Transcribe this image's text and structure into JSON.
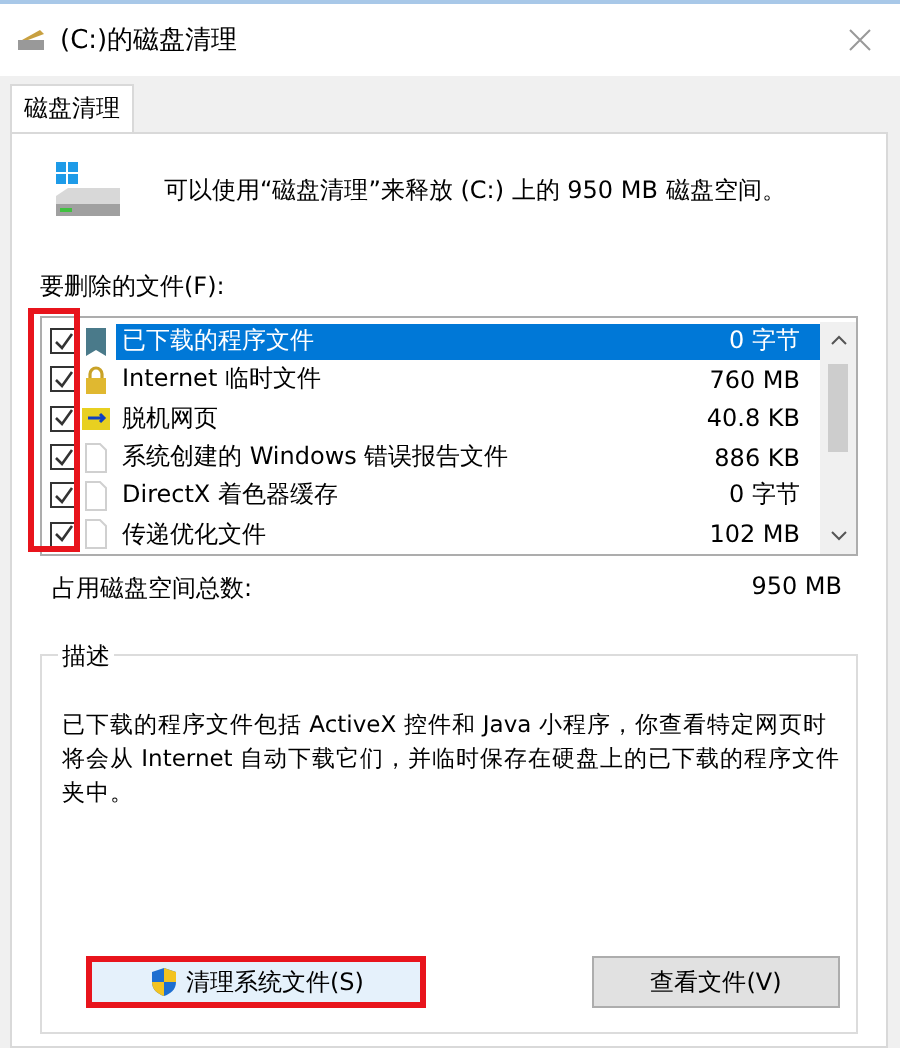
{
  "window": {
    "title": "(C:)的磁盘清理"
  },
  "tabs": [
    {
      "label": "磁盘清理",
      "selected": true
    }
  ],
  "intro": "可以使用“磁盘清理”来释放  (C:) 上的 950 MB 磁盘空间。",
  "files_label": "要删除的文件(F):",
  "files": [
    {
      "name": "已下载的程序文件",
      "size": "0 字节",
      "checked": true,
      "selected": true,
      "kind": "flag"
    },
    {
      "name": "Internet 临时文件",
      "size": "760 MB",
      "checked": true,
      "selected": false,
      "kind": "lock"
    },
    {
      "name": "脱机网页",
      "size": "40.8 KB",
      "checked": true,
      "selected": false,
      "kind": "sync"
    },
    {
      "name": "系统创建的 Windows 错误报告文件",
      "size": "886 KB",
      "checked": true,
      "selected": false,
      "kind": "page"
    },
    {
      "name": "DirectX 着色器缓存",
      "size": "0 字节",
      "checked": true,
      "selected": false,
      "kind": "page"
    },
    {
      "name": "传递优化文件",
      "size": "102 MB",
      "checked": true,
      "selected": false,
      "kind": "page"
    }
  ],
  "checkboxes_highlighted": true,
  "total": {
    "label": "占用磁盘空间总数:",
    "value": "950 MB"
  },
  "description": {
    "title": "描述",
    "text": "已下载的程序文件包括 ActiveX 控件和 Java 小程序，你查看特定网页时将会从 Internet 自动下载它们，并临时保存在硬盘上的已下载的程序文件夹中。"
  },
  "buttons": [
    {
      "label": "清理系统文件(S)",
      "kind": "shield",
      "highlighted": true
    },
    {
      "label": "查看文件(V)",
      "kind": "plain",
      "highlighted": false
    }
  ]
}
